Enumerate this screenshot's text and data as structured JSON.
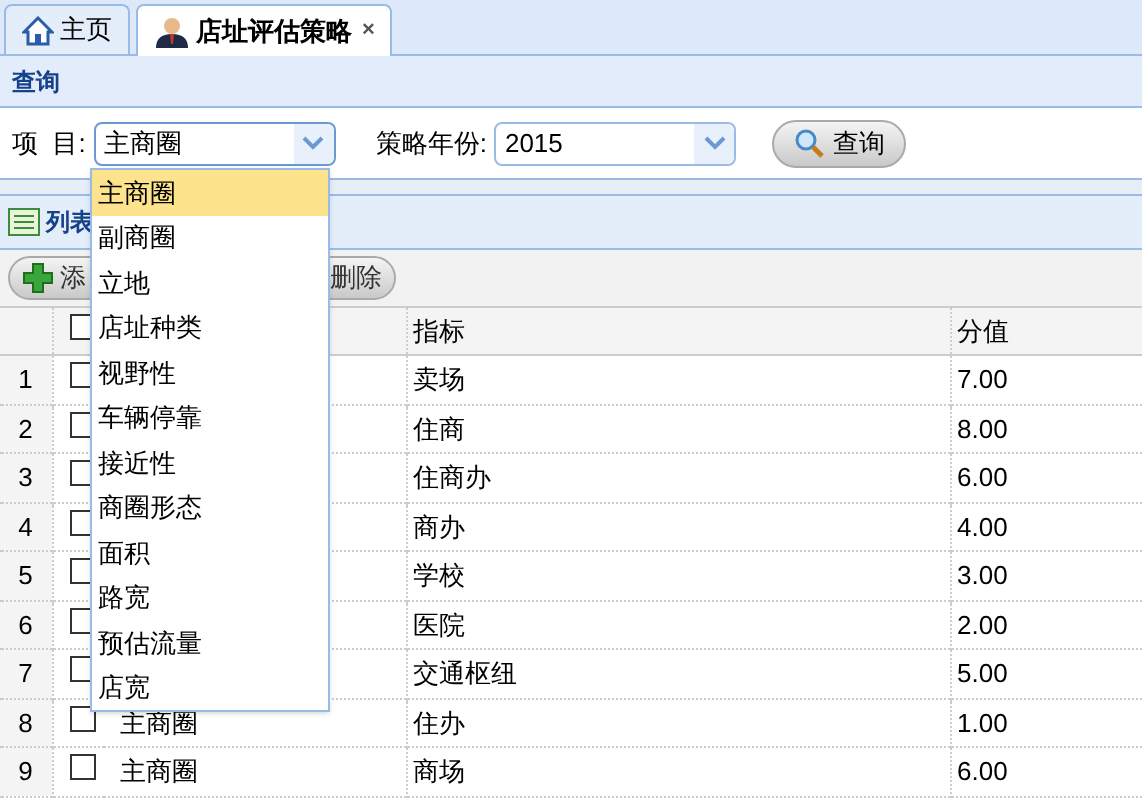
{
  "tabs": [
    {
      "label": "主页",
      "selected": false
    },
    {
      "label": "店址评估策略",
      "selected": true,
      "close": "×"
    }
  ],
  "query_panel": {
    "title": "查询",
    "fields": [
      {
        "label": "项  目:",
        "value": "主商圈",
        "open": true
      },
      {
        "label": "策略年份:",
        "value": "2015",
        "open": false
      }
    ],
    "search_button": "查询"
  },
  "dropdown": {
    "options": [
      {
        "label": "主商圈",
        "selected": true
      },
      {
        "label": "副商圈",
        "selected": false
      },
      {
        "label": "立地",
        "selected": false
      },
      {
        "label": "店址种类",
        "selected": false
      },
      {
        "label": "视野性",
        "selected": false
      },
      {
        "label": "车辆停靠",
        "selected": false
      },
      {
        "label": "接近性",
        "selected": false
      },
      {
        "label": "商圈形态",
        "selected": false
      },
      {
        "label": "面积",
        "selected": false
      },
      {
        "label": "路宽",
        "selected": false
      },
      {
        "label": "预估流量",
        "selected": false
      },
      {
        "label": "店宽",
        "selected": false
      }
    ]
  },
  "list_panel": {
    "title": "列表",
    "toolbar": [
      "添",
      "删除"
    ]
  },
  "table": {
    "all_checked": false,
    "columns": [
      "指标",
      "分值"
    ],
    "rows": [
      {
        "num": "1",
        "checked": false,
        "indicator": "卖场",
        "score": "7.00"
      },
      {
        "num": "2",
        "checked": false,
        "indicator": "住商",
        "score": "8.00"
      },
      {
        "num": "3",
        "checked": false,
        "indicator": "住商办",
        "score": "6.00"
      },
      {
        "num": "4",
        "checked": false,
        "indicator": "商办",
        "score": "4.00"
      },
      {
        "num": "5",
        "checked": false,
        "indicator": "学校",
        "score": "3.00"
      },
      {
        "num": "6",
        "checked": false,
        "indicator": "医院",
        "score": "2.00"
      },
      {
        "num": "7",
        "checked": false,
        "indicator": "交通枢纽",
        "score": "5.00"
      },
      {
        "num": "8",
        "checked": false,
        "project": "主商圈",
        "indicator": "住办",
        "score": "1.00"
      },
      {
        "num": "9",
        "checked": false,
        "project": "主商圈",
        "indicator": "商场",
        "score": "6.00"
      }
    ]
  }
}
